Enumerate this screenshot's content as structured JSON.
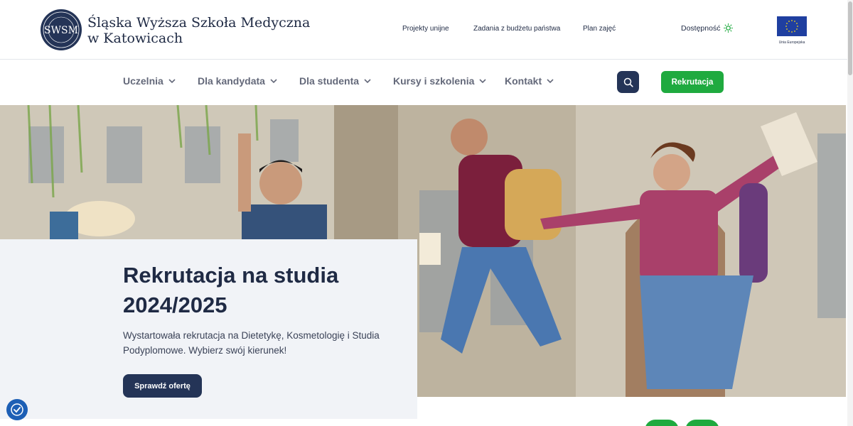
{
  "header": {
    "logo_text": "SWSM",
    "brand_line1": "Śląska Wyższa Szkoła Medyczna",
    "brand_line2": "w Katowicach",
    "links": [
      "Projekty unijne",
      "Zadania z budżetu państwa",
      "Plan zajęć"
    ],
    "accessibility_label": "Dostępność",
    "eu_label": "Unia Europejska"
  },
  "nav": {
    "items": [
      {
        "label": "Uczelnia",
        "icon": "chevron-down-icon"
      },
      {
        "label": "Dla kandydata",
        "icon": "chevron-down-icon"
      },
      {
        "label": "Dla studenta",
        "icon": "chevron-down-icon"
      },
      {
        "label": "Kursy i szkolenia",
        "icon": "chevron-down-icon"
      },
      {
        "label": "Kontakt",
        "icon": "chevron-down-icon"
      }
    ],
    "search_icon": "search-icon",
    "cta_label": "Rekrutacja"
  },
  "hero": {
    "title": "Rekrutacja na studia 2024/2025",
    "text": "Wystartowała rekrutacja na Dietetykę, Kosmetologię i Studia Podyplomowe. Wybierz swój kierunek!",
    "button_label": "Sprawdź ofertę"
  },
  "colors": {
    "navy": "#243457",
    "green": "#1faa3f",
    "text": "#1f2a44",
    "nav_text": "#64697a",
    "card_bg": "#f1f3f7"
  }
}
